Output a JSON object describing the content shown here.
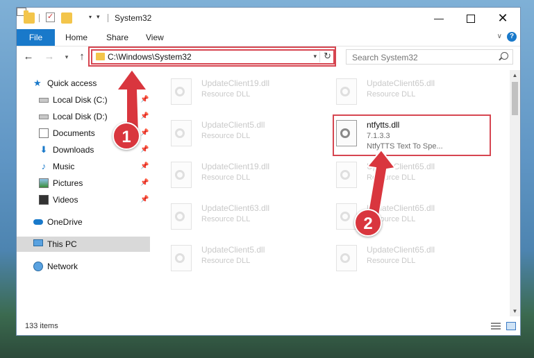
{
  "window": {
    "title": "System32",
    "min_glyph": "—",
    "close_glyph": "✕"
  },
  "ribbon": {
    "tabs": [
      {
        "label": "File"
      },
      {
        "label": "Home"
      },
      {
        "label": "Share"
      },
      {
        "label": "View"
      }
    ],
    "help_glyph": "?"
  },
  "nav": {
    "back_glyph": "←",
    "forward_glyph": "→",
    "recent_glyph": "▾",
    "up_glyph": "↑",
    "address": "C:\\Windows\\System32",
    "refresh_glyph": "↻",
    "search_placeholder": "Search System32"
  },
  "sidebar": {
    "items": [
      {
        "label": "Quick access"
      },
      {
        "label": "Local Disk (C:)"
      },
      {
        "label": "Local Disk (D:)"
      },
      {
        "label": "Documents"
      },
      {
        "label": "Downloads"
      },
      {
        "label": "Music"
      },
      {
        "label": "Pictures"
      },
      {
        "label": "Videos"
      },
      {
        "label": "OneDrive"
      },
      {
        "label": "This PC"
      },
      {
        "label": "Network"
      }
    ]
  },
  "files": [
    {
      "name": "UpdateClient19.dll",
      "type": "Resource DLL"
    },
    {
      "name": "UpdateClient65.dll",
      "type": "Resource DLL"
    },
    {
      "name": "UpdateClient5.dll",
      "type": "Resource DLL"
    },
    {
      "name": "ntfytts.dll",
      "version": "7.1.3.3",
      "description": "NtfyTTS Text To Spe..."
    },
    {
      "name": "UpdateClient19.dll",
      "type": "Resource DLL"
    },
    {
      "name": "UpdateClient65.dll",
      "type": "Resource DLL"
    },
    {
      "name": "UpdateClient63.dll",
      "type": "Resource DLL"
    },
    {
      "name": "UpdateClient65.dll",
      "type": "Resource DLL"
    },
    {
      "name": "UpdateClient5.dll",
      "type": "Resource DLL"
    },
    {
      "name": "UpdateClient65.dll",
      "type": "Resource DLL"
    }
  ],
  "status": {
    "item_count": "133 items"
  },
  "annotations": {
    "step1": "1",
    "step2": "2",
    "highlight_color": "#d64550",
    "badge_color": "#d9363e"
  },
  "colors": {
    "accent": "#1979ca",
    "selected_bg": "#d9d9d9"
  }
}
